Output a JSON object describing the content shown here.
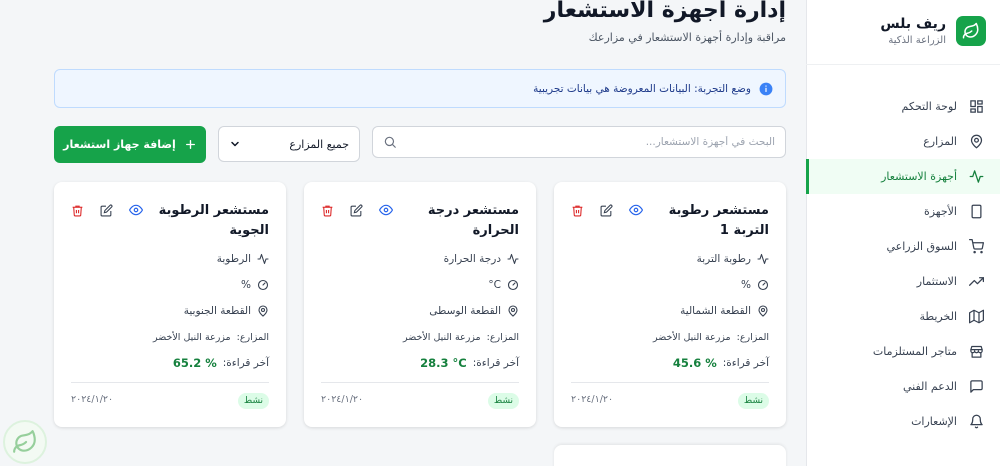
{
  "brand": {
    "name": "ريف بلس",
    "subtitle": "الزراعة الذكية"
  },
  "sidebar": {
    "items": [
      {
        "label": "لوحة التحكم",
        "icon": "dashboard-icon"
      },
      {
        "label": "المزارع",
        "icon": "map-pin-icon"
      },
      {
        "label": "أجهزة الاستشعار",
        "icon": "activity-icon",
        "active": true
      },
      {
        "label": "الأجهزة",
        "icon": "tablet-icon"
      },
      {
        "label": "السوق الزراعي",
        "icon": "cart-icon"
      },
      {
        "label": "الاستثمار",
        "icon": "trending-up-icon"
      },
      {
        "label": "الخريطة",
        "icon": "map-icon"
      },
      {
        "label": "متاجر المستلزمات",
        "icon": "store-icon"
      },
      {
        "label": "الدعم الفني",
        "icon": "chat-icon"
      },
      {
        "label": "الإشعارات",
        "icon": "bell-icon"
      }
    ]
  },
  "header": {
    "title": "إدارة أجهزة الاستشعار",
    "subtitle": "مراقبة وإدارة أجهزة الاستشعار في مزارعك"
  },
  "demo_banner": {
    "text": "وضع التجربة: البيانات المعروضة هي بيانات تجريبية"
  },
  "toolbar": {
    "search_placeholder": "البحث في أجهزة الاستشعار...",
    "farm_filter": "جميع المزارع",
    "add_button": "إضافة جهاز استشعار"
  },
  "labels": {
    "farmer_prefix": "المزارع:",
    "last_reading_prefix": "آخر قراءة:"
  },
  "sensors": [
    {
      "title": "مستشعر رطوبة التربة 1",
      "type": "رطوبة التربة",
      "unit": "%",
      "location": "القطعة الشمالية",
      "farmer": "مزرعة النيل الأخضر",
      "last_reading": "45.6 %",
      "status": "نشط",
      "date": "٢٠٢٤/١/٢٠"
    },
    {
      "title": "مستشعر درجة الحرارة",
      "type": "درجة الحرارة",
      "unit": "°C",
      "location": "القطعة الوسطى",
      "farmer": "مزرعة النيل الأخضر",
      "last_reading": "28.3 °C",
      "status": "نشط",
      "date": "٢٠٢٤/١/٢٠"
    },
    {
      "title": "مستشعر الرطوبة الجوية",
      "type": "الرطوبة",
      "unit": "%",
      "location": "القطعة الجنوبية",
      "farmer": "مزرعة النيل الأخضر",
      "last_reading": "65.2 %",
      "status": "نشط",
      "date": "٢٠٢٤/١/٢٠"
    }
  ],
  "colors": {
    "primary": "#16a34a",
    "primary_dark": "#15803d",
    "info": "#3b82f6",
    "danger": "#dc2626"
  }
}
